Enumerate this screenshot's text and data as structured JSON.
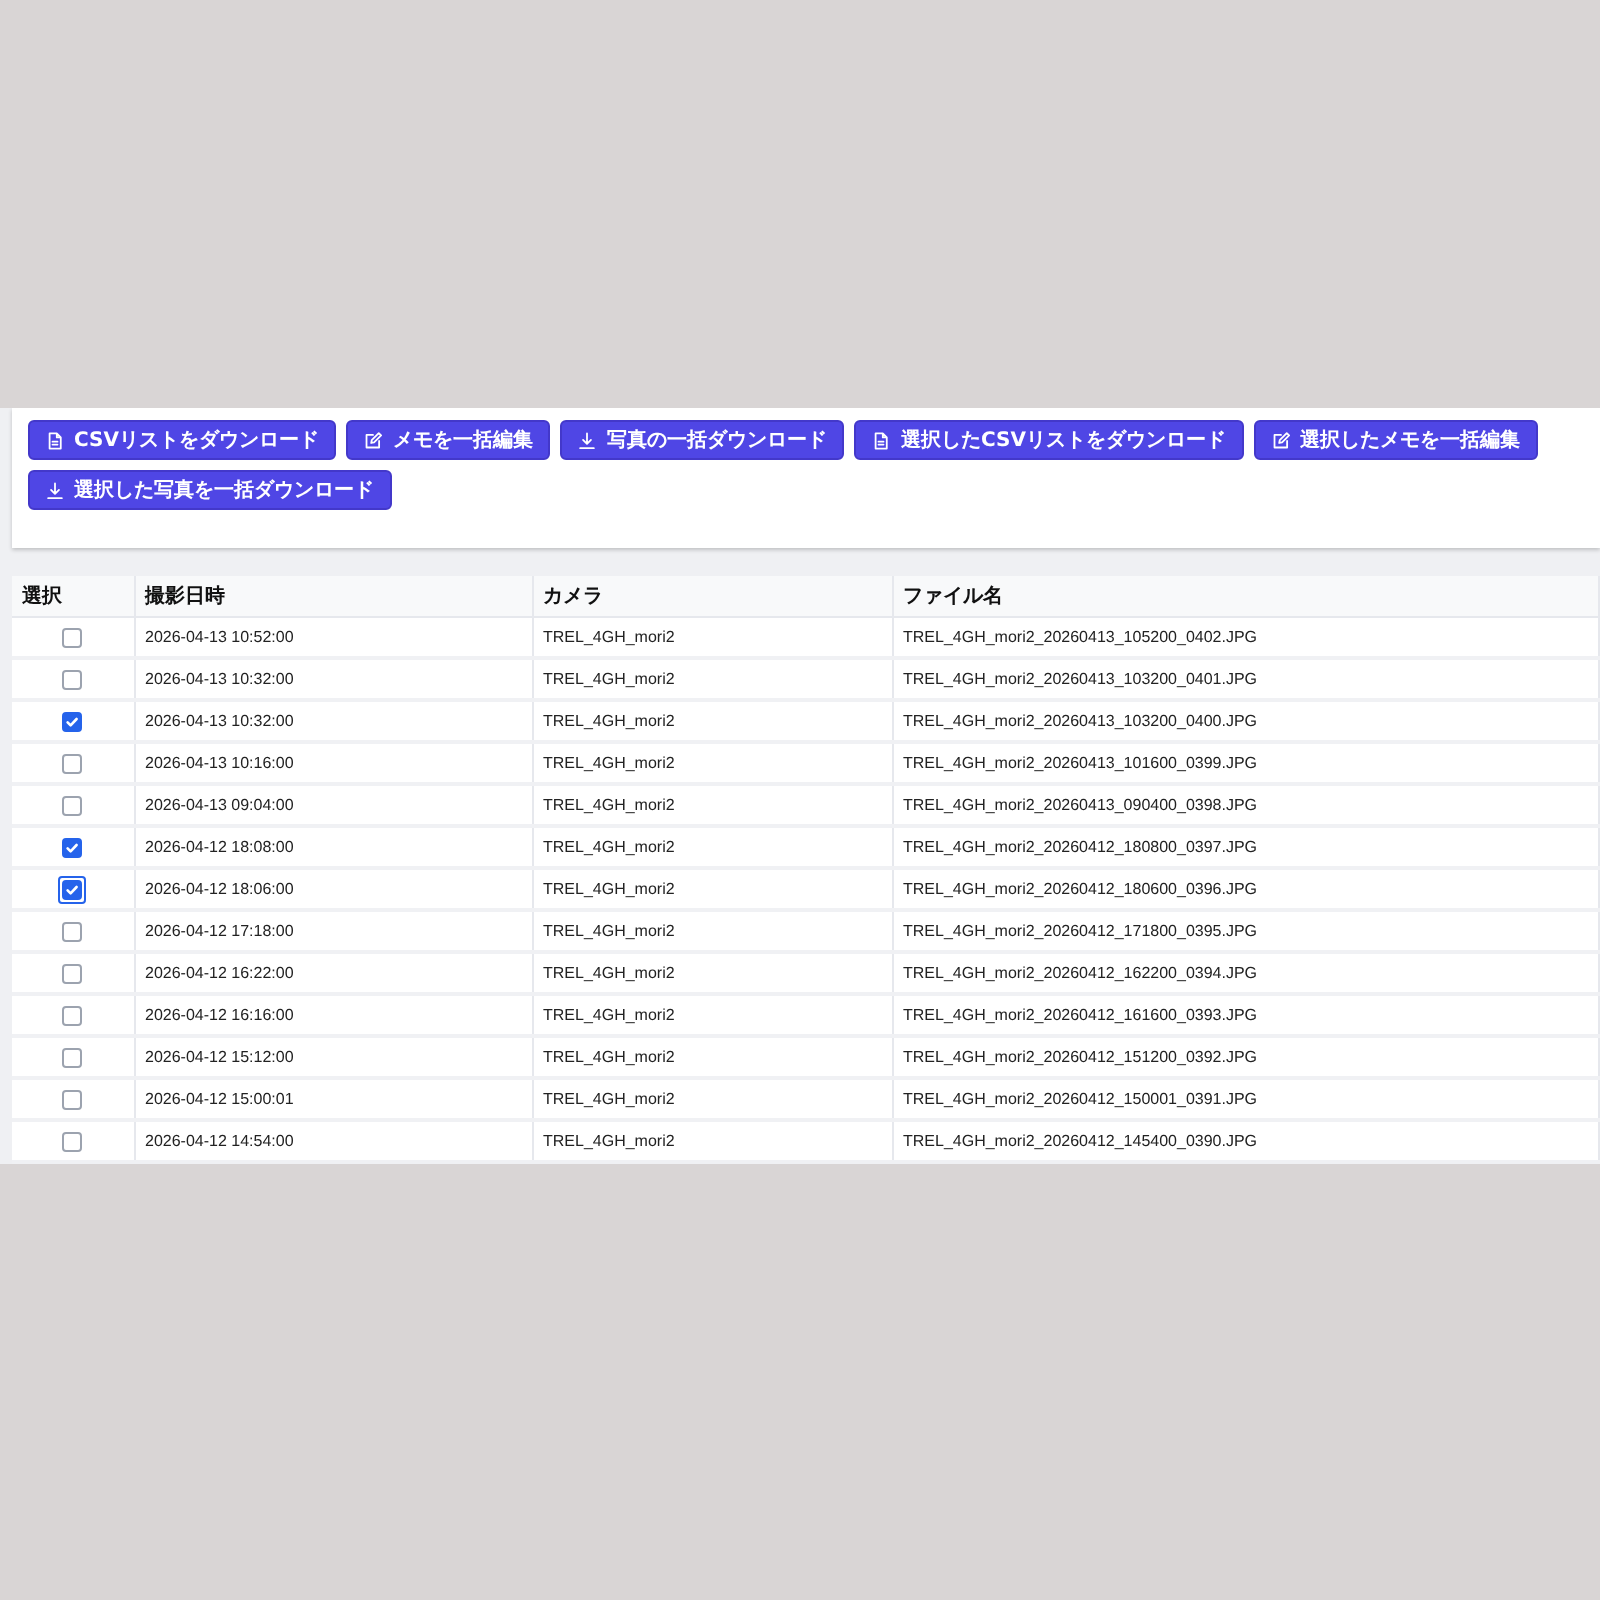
{
  "toolbar": {
    "buttons": [
      {
        "kind": "file",
        "label": "CSVリストをダウンロード"
      },
      {
        "kind": "edit",
        "label": "メモを一括編集"
      },
      {
        "kind": "download",
        "label": "写真の一括ダウンロード"
      },
      {
        "kind": "file",
        "label": "選択したCSVリストをダウンロード"
      },
      {
        "kind": "edit",
        "label": "選択したメモを一括編集"
      },
      {
        "kind": "download",
        "label": "選択した写真を一括ダウンロード"
      }
    ]
  },
  "table": {
    "columns": [
      "選択",
      "撮影日時",
      "カメラ",
      "ファイル名"
    ],
    "rows": [
      {
        "checked": false,
        "focused": false,
        "taken_at": "2026-04-13 10:52:00",
        "camera": "TREL_4GH_mori2",
        "file_name": "TREL_4GH_mori2_20260413_105200_0402.JPG"
      },
      {
        "checked": false,
        "focused": false,
        "taken_at": "2026-04-13 10:32:00",
        "camera": "TREL_4GH_mori2",
        "file_name": "TREL_4GH_mori2_20260413_103200_0401.JPG"
      },
      {
        "checked": true,
        "focused": false,
        "taken_at": "2026-04-13 10:32:00",
        "camera": "TREL_4GH_mori2",
        "file_name": "TREL_4GH_mori2_20260413_103200_0400.JPG"
      },
      {
        "checked": false,
        "focused": false,
        "taken_at": "2026-04-13 10:16:00",
        "camera": "TREL_4GH_mori2",
        "file_name": "TREL_4GH_mori2_20260413_101600_0399.JPG"
      },
      {
        "checked": false,
        "focused": false,
        "taken_at": "2026-04-13 09:04:00",
        "camera": "TREL_4GH_mori2",
        "file_name": "TREL_4GH_mori2_20260413_090400_0398.JPG"
      },
      {
        "checked": true,
        "focused": false,
        "taken_at": "2026-04-12 18:08:00",
        "camera": "TREL_4GH_mori2",
        "file_name": "TREL_4GH_mori2_20260412_180800_0397.JPG"
      },
      {
        "checked": true,
        "focused": true,
        "taken_at": "2026-04-12 18:06:00",
        "camera": "TREL_4GH_mori2",
        "file_name": "TREL_4GH_mori2_20260412_180600_0396.JPG"
      },
      {
        "checked": false,
        "focused": false,
        "taken_at": "2026-04-12 17:18:00",
        "camera": "TREL_4GH_mori2",
        "file_name": "TREL_4GH_mori2_20260412_171800_0395.JPG"
      },
      {
        "checked": false,
        "focused": false,
        "taken_at": "2026-04-12 16:22:00",
        "camera": "TREL_4GH_mori2",
        "file_name": "TREL_4GH_mori2_20260412_162200_0394.JPG"
      },
      {
        "checked": false,
        "focused": false,
        "taken_at": "2026-04-12 16:16:00",
        "camera": "TREL_4GH_mori2",
        "file_name": "TREL_4GH_mori2_20260412_161600_0393.JPG"
      },
      {
        "checked": false,
        "focused": false,
        "taken_at": "2026-04-12 15:12:00",
        "camera": "TREL_4GH_mori2",
        "file_name": "TREL_4GH_mori2_20260412_151200_0392.JPG"
      },
      {
        "checked": false,
        "focused": false,
        "taken_at": "2026-04-12 15:00:01",
        "camera": "TREL_4GH_mori2",
        "file_name": "TREL_4GH_mori2_20260412_150001_0391.JPG"
      },
      {
        "checked": false,
        "focused": false,
        "taken_at": "2026-04-12 14:54:00",
        "camera": "TREL_4GH_mori2",
        "file_name": "TREL_4GH_mori2_20260412_145400_0390.JPG"
      }
    ]
  }
}
